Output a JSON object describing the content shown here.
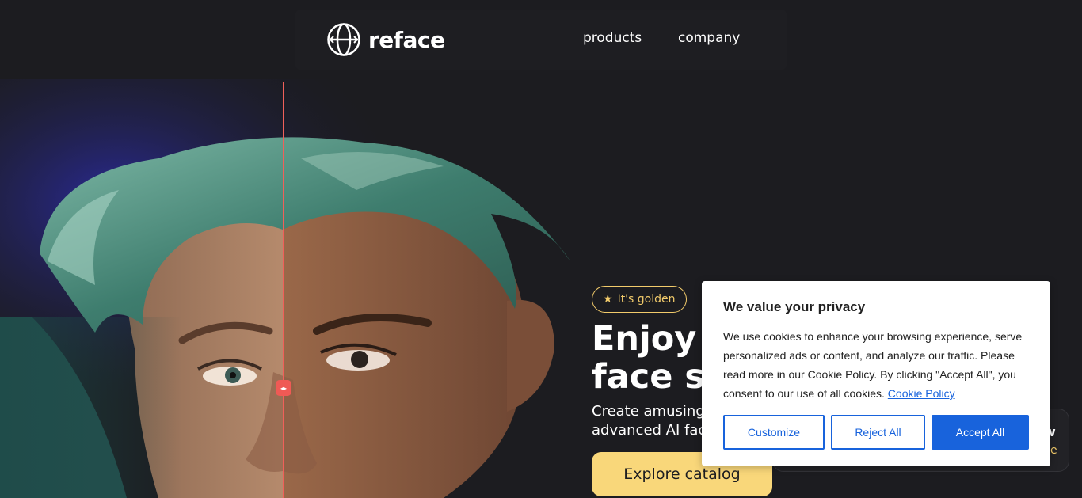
{
  "brand": {
    "name": "reface",
    "logo_icon": "reface-globe-logo-icon"
  },
  "nav": {
    "products": "products",
    "company": "company"
  },
  "hero": {
    "badge_icon": "star-icon",
    "badge_label": "It's golden",
    "title_line1": "Enjoy",
    "title_line2": "face s",
    "subtitle_line1": "Create amusing",
    "subtitle_line2": "advanced AI fac",
    "cta_label": "Explore catalog",
    "compare_handle_icon": "left-right-arrows-icon"
  },
  "side_card": {
    "text_a": "w",
    "text_b": "e"
  },
  "cookie": {
    "title": "We value your privacy",
    "text": "We use cookies to enhance your browsing experience, serve personalized ads or content, and analyze our traffic. Please read more in our Cookie Policy. By clicking \"Accept All\", you consent to our use of all cookies.",
    "link_label": "Cookie Policy",
    "customize_label": "Customize",
    "reject_label": "Reject All",
    "accept_label": "Accept All"
  },
  "colors": {
    "background": "#1c1c20",
    "accent_yellow": "#f9d77a",
    "badge_gold": "#f2cb6b",
    "compare_red": "#f0605a",
    "cookie_blue": "#1863dc"
  }
}
